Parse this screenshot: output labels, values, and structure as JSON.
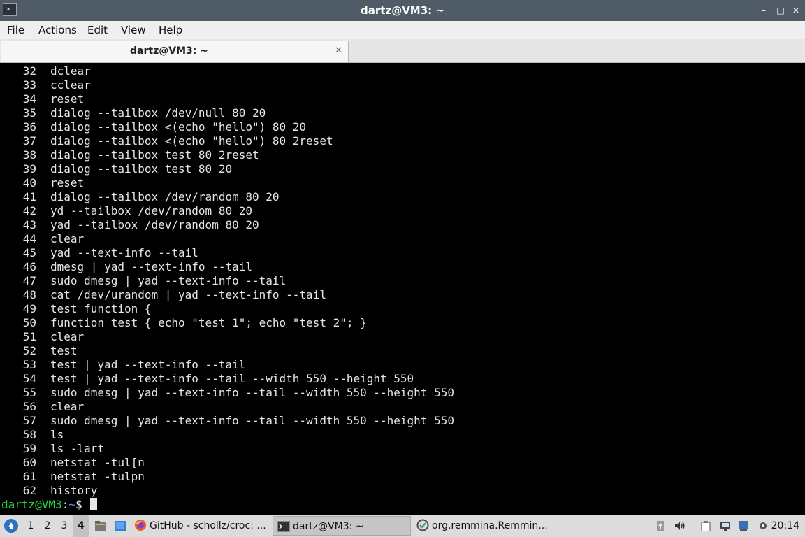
{
  "window": {
    "title": "dartz@VM3: ~",
    "app_icon_glyph": ">_",
    "buttons": [
      "–",
      "□",
      "✕"
    ]
  },
  "menu": [
    "File",
    "Actions",
    "Edit",
    "View",
    "Help"
  ],
  "tab": {
    "label": "dartz@VM3: ~",
    "close": "✕"
  },
  "history": [
    {
      "n": "32",
      "cmd": "dclear"
    },
    {
      "n": "33",
      "cmd": "cclear"
    },
    {
      "n": "34",
      "cmd": "reset"
    },
    {
      "n": "35",
      "cmd": "dialog --tailbox /dev/null 80 20"
    },
    {
      "n": "36",
      "cmd": "dialog --tailbox <(echo \"hello\") 80 20"
    },
    {
      "n": "37",
      "cmd": "dialog --tailbox <(echo \"hello\") 80 2reset"
    },
    {
      "n": "38",
      "cmd": "dialog --tailbox test 80 2reset"
    },
    {
      "n": "39",
      "cmd": "dialog --tailbox test 80 20"
    },
    {
      "n": "40",
      "cmd": "reset"
    },
    {
      "n": "41",
      "cmd": "dialog --tailbox /dev/random 80 20"
    },
    {
      "n": "42",
      "cmd": "yd --tailbox /dev/random 80 20"
    },
    {
      "n": "43",
      "cmd": "yad --tailbox /dev/random 80 20"
    },
    {
      "n": "44",
      "cmd": "clear"
    },
    {
      "n": "45",
      "cmd": "yad --text-info --tail"
    },
    {
      "n": "46",
      "cmd": "dmesg | yad --text-info --tail"
    },
    {
      "n": "47",
      "cmd": "sudo dmesg | yad --text-info --tail"
    },
    {
      "n": "48",
      "cmd": "cat /dev/urandom | yad --text-info --tail"
    },
    {
      "n": "49",
      "cmd": "test_function {"
    },
    {
      "n": "50",
      "cmd": "function test { echo \"test 1\"; echo \"test 2\"; }"
    },
    {
      "n": "51",
      "cmd": "clear"
    },
    {
      "n": "52",
      "cmd": "test"
    },
    {
      "n": "53",
      "cmd": "test | yad --text-info --tail"
    },
    {
      "n": "54",
      "cmd": "test | yad --text-info --tail --width 550 --height 550"
    },
    {
      "n": "55",
      "cmd": "sudo dmesg | yad --text-info --tail --width 550 --height 550"
    },
    {
      "n": "56",
      "cmd": "clear"
    },
    {
      "n": "57",
      "cmd": "sudo dmesg | yad --text-info --tail --width 550 --height 550"
    },
    {
      "n": "58",
      "cmd": "ls"
    },
    {
      "n": "59",
      "cmd": "ls -lart"
    },
    {
      "n": "60",
      "cmd": "netstat -tul[n"
    },
    {
      "n": "61",
      "cmd": "netstat -tulpn"
    },
    {
      "n": "62",
      "cmd": "history"
    }
  ],
  "prompt": {
    "user": "dartz@VM3",
    "sep": ":",
    "path": "~",
    "symbol": "$ "
  },
  "taskbar": {
    "workspaces": [
      "1",
      "2",
      "3",
      "4"
    ],
    "active_workspace": "4",
    "tasks": [
      {
        "label": "GitHub - schollz/croc: ...",
        "icon": "firefox-icon"
      },
      {
        "label": "dartz@VM3: ~",
        "icon": "terminal-icon"
      },
      {
        "label": "org.remmina.Remmin...",
        "icon": "remmina-icon"
      }
    ],
    "clock": "20:14"
  },
  "colors": {
    "prompt_user": "#27d341",
    "prompt_path": "#5b8de6",
    "titlebar": "#4f5b66"
  }
}
